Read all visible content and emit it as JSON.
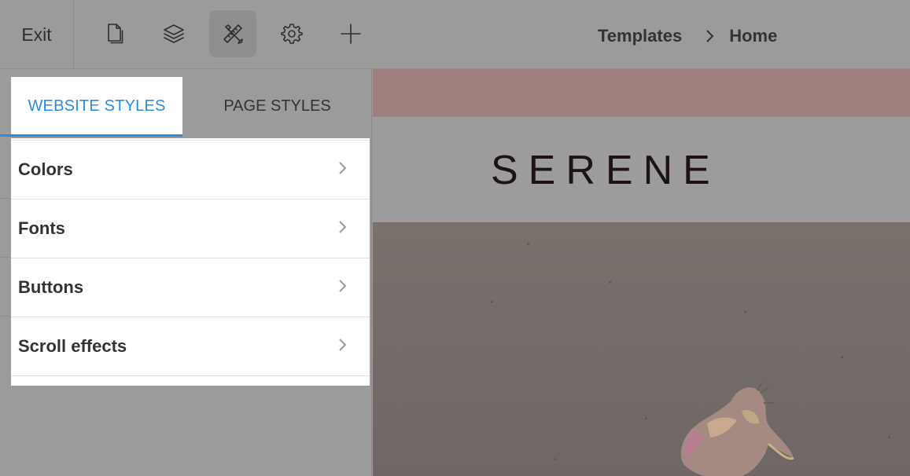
{
  "topbar": {
    "exit_label": "Exit",
    "tools": [
      {
        "name": "pages-icon",
        "active": false
      },
      {
        "name": "layers-icon",
        "active": false
      },
      {
        "name": "design-tools-icon",
        "active": true
      },
      {
        "name": "gear-icon",
        "active": false
      },
      {
        "name": "plus-icon",
        "active": false
      }
    ],
    "breadcrumb": [
      "Templates",
      "Home"
    ]
  },
  "panel": {
    "tabs": [
      {
        "label": "WEBSITE STYLES",
        "active": true
      },
      {
        "label": "PAGE STYLES",
        "active": false
      }
    ],
    "items": [
      {
        "label": "Colors"
      },
      {
        "label": "Fonts"
      },
      {
        "label": "Buttons"
      },
      {
        "label": "Scroll effects"
      }
    ],
    "accent_color": "#2a8ce0"
  },
  "preview": {
    "logo": "SERENE",
    "announcement_color": "#a07f7f"
  }
}
